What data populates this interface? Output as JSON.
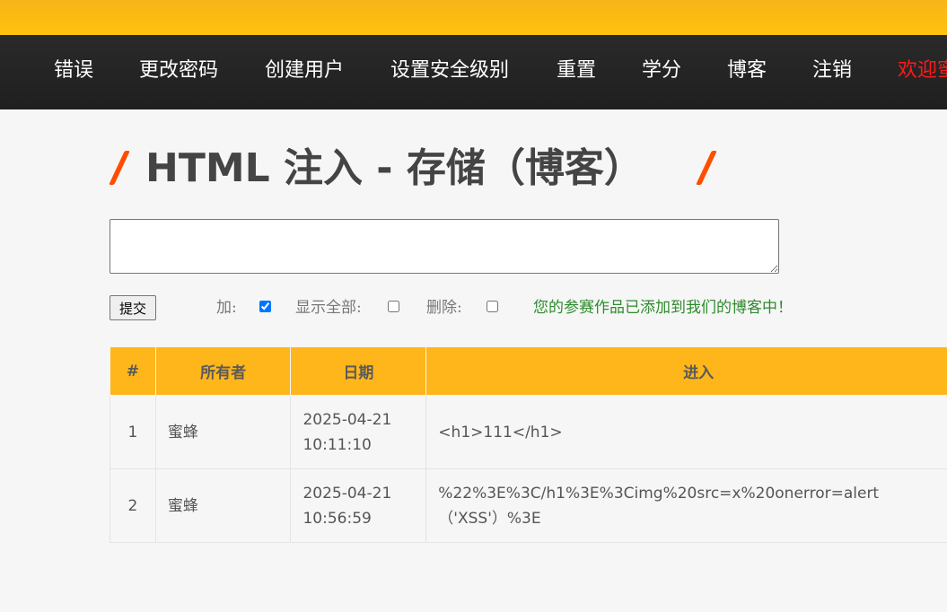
{
  "header": {
    "menu": [
      "错误",
      "更改密码",
      "创建用户",
      "设置安全级别",
      "重置",
      "学分",
      "博客",
      "注销"
    ],
    "welcome": "欢迎蜜蜂"
  },
  "page": {
    "title": "HTML 注入 - 存储（博客）"
  },
  "form": {
    "entry_value": "",
    "submit_label": "提交",
    "add_label": "加:",
    "add_checked": true,
    "show_all_label": "显示全部:",
    "show_all_checked": false,
    "delete_label": "删除:",
    "delete_checked": false,
    "status_message": "您的参赛作品已添加到我们的博客中！"
  },
  "table": {
    "columns": [
      "#",
      "所有者",
      "日期",
      "进入"
    ],
    "rows": [
      {
        "id": "1",
        "owner": "蜜蜂",
        "date_line1": "2025-04-21",
        "date_line2": "10:11:10",
        "entry_line1": "<h1>111</h1>",
        "entry_line2": ""
      },
      {
        "id": "2",
        "owner": "蜜蜂",
        "date_line1": "2025-04-21",
        "date_line2": "10:56:59",
        "entry_line1": "%22%3E%3C/h1%3E%3Cimg%20src=x%20onerror=alert",
        "entry_line2": "（'XSS'）%3E"
      }
    ]
  },
  "colors": {
    "accent": "#ffb61b",
    "menu_bg": "#222222",
    "welcome": "#ff1a1a",
    "status": "#2e8b2e",
    "title_slash": "#ff4d00"
  }
}
